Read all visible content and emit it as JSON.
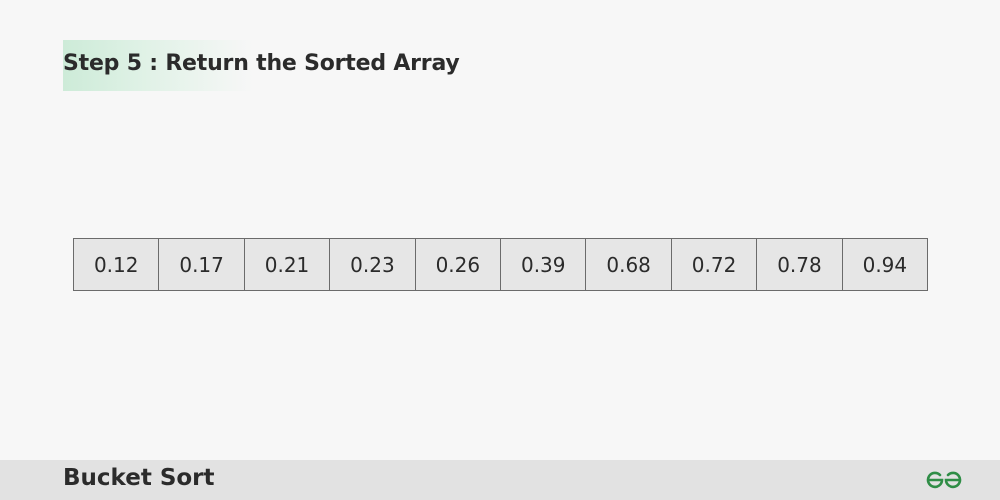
{
  "step_heading": "Step 5 : Return the Sorted Array",
  "sorted_array": [
    "0.12",
    "0.17",
    "0.21",
    "0.23",
    "0.26",
    "0.39",
    "0.68",
    "0.72",
    "0.78",
    "0.94"
  ],
  "footer": {
    "title": "Bucket Sort",
    "logo": "geeksforgeeks-logo-icon"
  },
  "colors": {
    "background": "#f7f7f7",
    "heading_highlight": "#cdebd8",
    "cell_fill": "#e6e6e6",
    "cell_border": "#6b6b6b",
    "footer_bar": "#e2e2e2",
    "logo_green": "#2f8d46"
  }
}
